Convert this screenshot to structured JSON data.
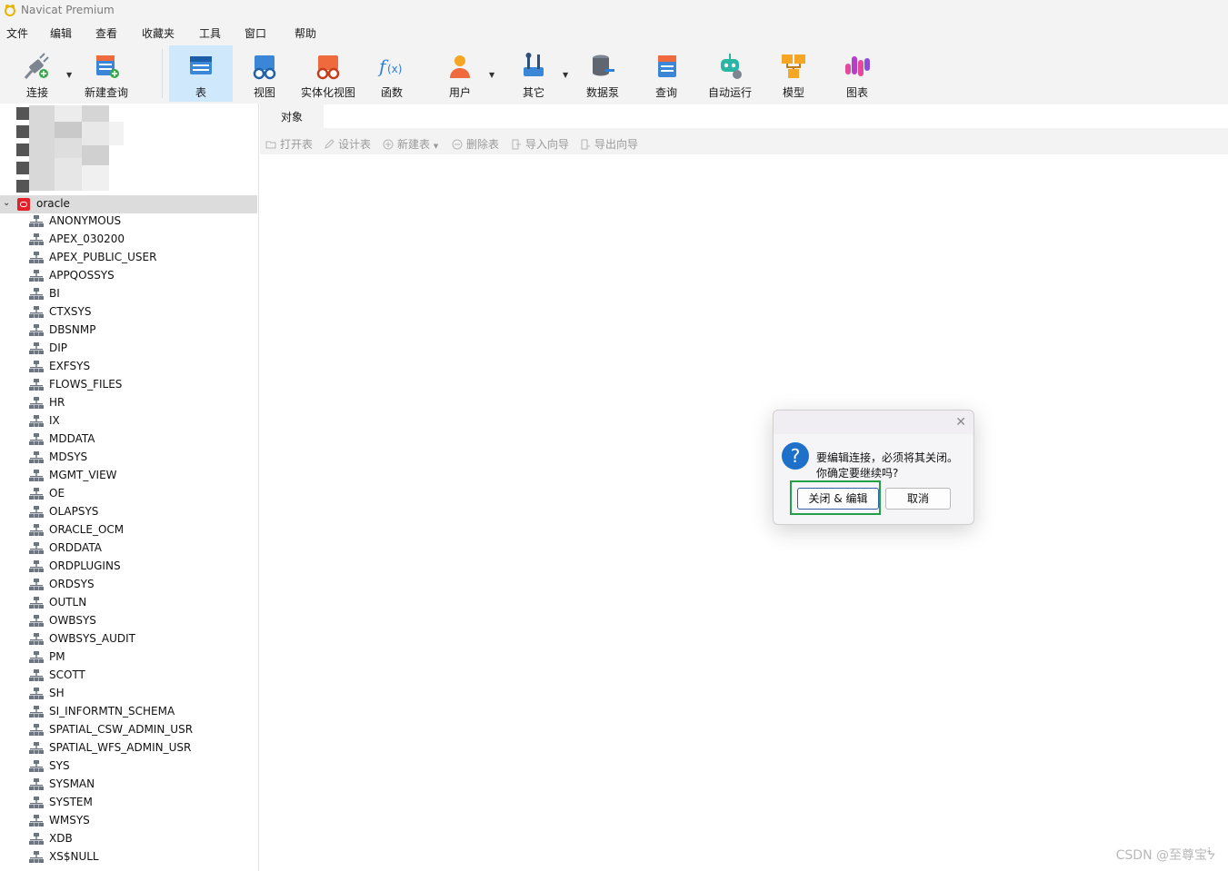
{
  "window": {
    "title": "Navicat Premium"
  },
  "menu": [
    "文件",
    "编辑",
    "查看",
    "收藏夹",
    "工具",
    "窗口",
    "帮助"
  ],
  "toolbar": {
    "buttons": [
      {
        "label": "连接",
        "icon": "plug-icon",
        "has_dropdown": true
      },
      {
        "label": "新建查询",
        "icon": "new-query-icon"
      },
      {
        "label": "表",
        "icon": "table-icon",
        "active": true
      },
      {
        "label": "视图",
        "icon": "view-icon"
      },
      {
        "label": "实体化视图",
        "icon": "materialized-view-icon"
      },
      {
        "label": "函数",
        "icon": "function-icon"
      },
      {
        "label": "用户",
        "icon": "user-icon",
        "has_dropdown": true
      },
      {
        "label": "其它",
        "icon": "tools-icon",
        "has_dropdown": true
      },
      {
        "label": "数据泵",
        "icon": "datapump-icon"
      },
      {
        "label": "查询",
        "icon": "query-icon"
      },
      {
        "label": "自动运行",
        "icon": "robot-icon"
      },
      {
        "label": "模型",
        "icon": "model-icon"
      },
      {
        "label": "图表",
        "icon": "chart-icon"
      }
    ]
  },
  "navigator": {
    "connection": "oracle",
    "schemas": [
      "ANONYMOUS",
      "APEX_030200",
      "APEX_PUBLIC_USER",
      "APPQOSSYS",
      "BI",
      "CTXSYS",
      "DBSNMP",
      "DIP",
      "EXFSYS",
      "FLOWS_FILES",
      "HR",
      "IX",
      "MDDATA",
      "MDSYS",
      "MGMT_VIEW",
      "OE",
      "OLAPSYS",
      "ORACLE_OCM",
      "ORDDATA",
      "ORDPLUGINS",
      "ORDSYS",
      "OUTLN",
      "OWBSYS",
      "OWBSYS_AUDIT",
      "PM",
      "SCOTT",
      "SH",
      "SI_INFORMTN_SCHEMA",
      "SPATIAL_CSW_ADMIN_USR",
      "SPATIAL_WFS_ADMIN_USR",
      "SYS",
      "SYSMAN",
      "SYSTEM",
      "WMSYS",
      "XDB",
      "XS$NULL"
    ]
  },
  "tabs": {
    "objects": "对象"
  },
  "object_toolbar": {
    "open_table": "打开表",
    "design_table": "设计表",
    "new_table": "新建表",
    "delete_table": "删除表",
    "import_wizard": "导入向导",
    "export_wizard": "导出向导"
  },
  "dialog": {
    "message_line1": "要编辑连接，必须将其关闭。",
    "message_line2": "你确定要继续吗?",
    "confirm_label": "关闭 & 编辑",
    "cancel_label": "取消",
    "close_glyph": "✕",
    "question_glyph": "?"
  },
  "watermark": "CSDN @至尊宝ᖭ",
  "colors": {
    "active_tab": "#cfe8fb",
    "oracle_red": "#e4202a",
    "highlight_green": "#21a047"
  }
}
